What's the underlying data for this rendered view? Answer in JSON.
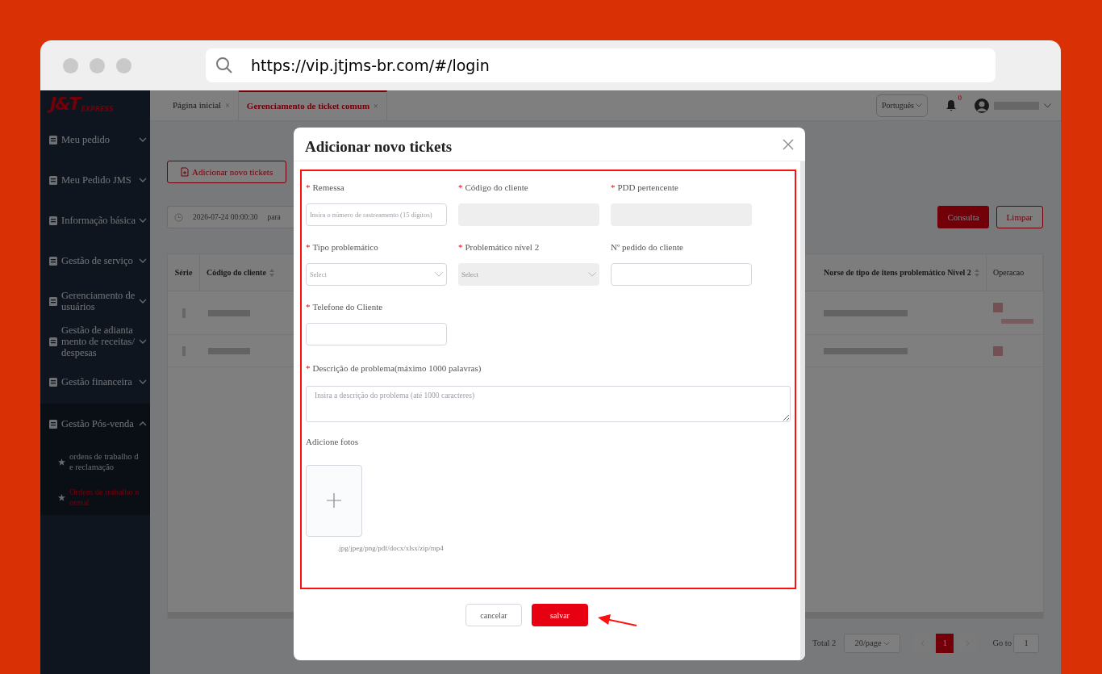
{
  "browser": {
    "url": "https://vip.jtjms-br.com/#/login"
  },
  "sidebar": {
    "logo": {
      "brand": "J&T",
      "sub": "EXPRESS"
    },
    "items": [
      {
        "label": "Meu pedido",
        "expanded": false
      },
      {
        "label": "Meu Pedido JMS",
        "expanded": false
      },
      {
        "label": "Informação básica",
        "expanded": false
      },
      {
        "label": "Gestão de serviço",
        "expanded": false
      },
      {
        "label": "Gerenciamento de usuários",
        "expanded": false
      },
      {
        "label": "Gestão de adiantamento de receitas/despesas",
        "expanded": false
      },
      {
        "label": "Gestão financeira",
        "expanded": false
      },
      {
        "label": "Gestão Pós-venda",
        "expanded": true,
        "children": [
          {
            "label": "ordens de trabalho de reclamação",
            "selected": false
          },
          {
            "label": "Ordem de trabalho normal",
            "selected": true
          }
        ]
      }
    ]
  },
  "tabs": [
    {
      "label": "Página inicial",
      "selected": false,
      "close": "×"
    },
    {
      "label": "Gerenciamento de ticket comum",
      "selected": true,
      "close": "×"
    }
  ],
  "header": {
    "language": "Português",
    "notifications": "0"
  },
  "toolbar": {
    "add_button": "Adicionar novo tickets"
  },
  "filter": {
    "date_from": "2026-07-24 00:00:30",
    "separator": "para",
    "buttons": [
      {
        "label": "Consulta",
        "kind": "primary"
      },
      {
        "label": "Limpar",
        "kind": "outline"
      }
    ]
  },
  "table": {
    "columns": [
      {
        "label": "Série",
        "sortable": false
      },
      {
        "label": "Código do cliente",
        "sortable": true
      },
      {
        "label": "Norse de tipo de itens problemático Nível 2",
        "sortable": true
      },
      {
        "label": "Operacao",
        "sortable": false
      }
    ]
  },
  "pagination": {
    "total": "Total 2",
    "page_size": "20/page",
    "pages": [
      {
        "label": "1",
        "selected": true
      }
    ],
    "goto_label": "Go to",
    "goto_value": "1"
  },
  "modal": {
    "title": "Adicionar novo tickets",
    "required_mark": "*",
    "fields": [
      {
        "label": "Remessa",
        "required": true,
        "kind": "input",
        "placeholder": "Insira o número de rastreamento (15 dígitos)"
      },
      {
        "label": "Código do cliente",
        "required": true,
        "kind": "disabled"
      },
      {
        "label": "PDD pertencente",
        "required": true,
        "kind": "disabled"
      },
      {
        "label": "Tipo problemático",
        "required": true,
        "kind": "select",
        "placeholder": "Select"
      },
      {
        "label": "Problemático nível 2",
        "required": true,
        "kind": "select_disabled",
        "placeholder": "Select"
      },
      {
        "label": "Nº pedido do cliente",
        "required": false,
        "kind": "input"
      },
      {
        "label": "Telefone do Cliente",
        "required": true,
        "kind": "input"
      }
    ],
    "description": {
      "label": "Descrição de problema(máximo 1000 palavras)",
      "required": true,
      "placeholder": "Insira a descrição do problema (até 1000 caracteres)"
    },
    "upload": {
      "label": "Adicione fotos",
      "hint": ".jpg/jpeg/png/pdf/docx/xlsx/zip/mp4"
    },
    "buttons": [
      {
        "label": "cancelar",
        "kind": "secondary"
      },
      {
        "label": "salvar",
        "kind": "primary"
      }
    ]
  }
}
